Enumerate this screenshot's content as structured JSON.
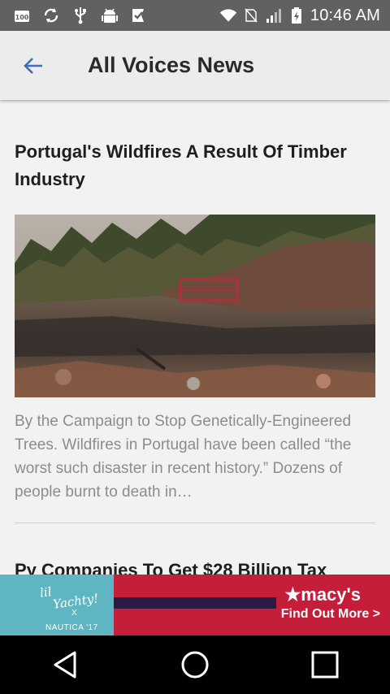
{
  "status_bar": {
    "time": "10:46 AM",
    "left_icons": [
      "hundred-icon",
      "sync-icon",
      "usb-icon",
      "android-debug-icon",
      "check-flag-icon"
    ],
    "right_icons": [
      "wifi-icon",
      "no-sim-icon",
      "signal-icon",
      "battery-charging-icon"
    ]
  },
  "app_bar": {
    "title": "All Voices News",
    "back_icon": "arrow-back-icon",
    "accent": "#3f6fb5"
  },
  "article": {
    "title": "Portugal's Wildfires A Result Of Timber Industry",
    "image": "wildfire-scorched-landscape",
    "description": "By the Campaign to Stop Genetically-Engineered Trees. Wildfires in Portugal have been called “the worst such disaster in recent history.” Dozens of people burnt to death in…"
  },
  "next_article": {
    "title": "Py Companies To Get $28 Billion Tax"
  },
  "ad": {
    "script_line1": "lil",
    "script_line2": "Yachty!",
    "x_mark": "X",
    "collab": "NAUTICA '17",
    "brand": "★macy's",
    "cta": "Find Out More >"
  },
  "nav_bar": {
    "icons": [
      "back-triangle-icon",
      "home-circle-icon",
      "recents-square-icon"
    ]
  }
}
